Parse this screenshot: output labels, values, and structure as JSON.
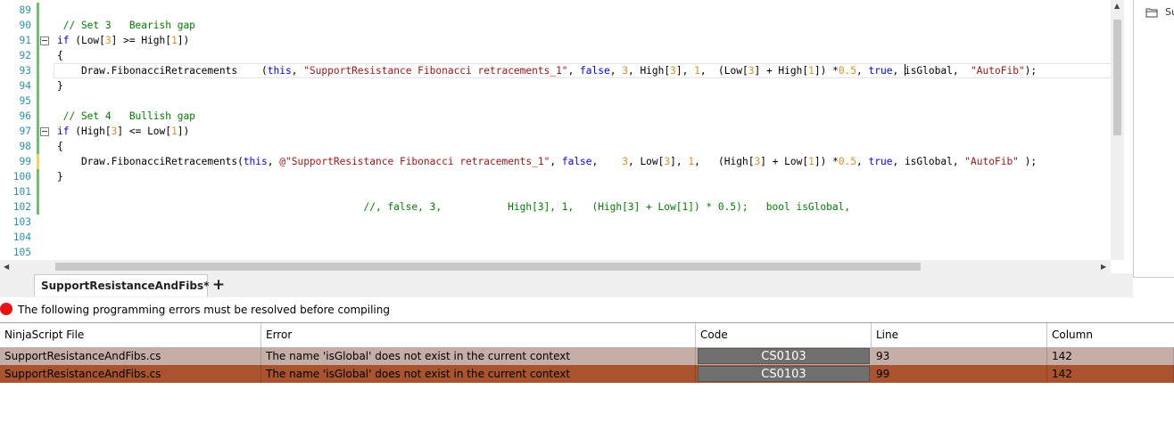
{
  "editor": {
    "lines": [
      {
        "n": "89",
        "marker": "g",
        "html": ""
      },
      {
        "n": "90",
        "marker": "g",
        "segs": [
          [
            "cm",
            " // Set 3   Bearish gap"
          ]
        ]
      },
      {
        "n": "91",
        "marker": "g",
        "fold": true,
        "segs": [
          [
            "kw",
            "if"
          ],
          [
            "",
            " (Low["
          ],
          [
            "num",
            "3"
          ],
          [
            "",
            "] >= High["
          ],
          [
            "num",
            "1"
          ],
          [
            "",
            "])"
          ]
        ]
      },
      {
        "n": "92",
        "marker": "g",
        "segs": [
          [
            "",
            "{"
          ]
        ]
      },
      {
        "n": "93",
        "marker": "g",
        "current": true,
        "segs": [
          [
            "",
            "    Draw.FibonacciRetracements    ("
          ],
          [
            "kw",
            "this"
          ],
          [
            "",
            ", "
          ],
          [
            "str",
            "\"SupportResistance Fibonacci retracements_1\""
          ],
          [
            "",
            ", "
          ],
          [
            "kw",
            "false"
          ],
          [
            "",
            ", "
          ],
          [
            "num",
            "3"
          ],
          [
            "",
            ", High["
          ],
          [
            "num",
            "3"
          ],
          [
            "",
            "], "
          ],
          [
            "num",
            "1"
          ],
          [
            "",
            ",  (Low["
          ],
          [
            "num",
            "3"
          ],
          [
            "",
            "] + High["
          ],
          [
            "num",
            "1"
          ],
          [
            "",
            "]) *"
          ],
          [
            "num",
            "0.5"
          ],
          [
            "",
            ", "
          ],
          [
            "kw",
            "true"
          ],
          [
            "",
            ", "
          ],
          [
            "caret",
            ""
          ],
          [
            "",
            "isGlobal,  "
          ],
          [
            "str",
            "\"AutoFib\""
          ],
          [
            "",
            ");"
          ]
        ]
      },
      {
        "n": "94",
        "marker": "g",
        "segs": [
          [
            "",
            "}"
          ]
        ]
      },
      {
        "n": "95",
        "marker": "g",
        "segs": []
      },
      {
        "n": "96",
        "marker": "g",
        "segs": [
          [
            "cm",
            " // Set 4   Bullish gap"
          ]
        ]
      },
      {
        "n": "97",
        "marker": "g",
        "fold": true,
        "segs": [
          [
            "kw",
            "if"
          ],
          [
            "",
            " (High["
          ],
          [
            "num",
            "3"
          ],
          [
            "",
            "] <= Low["
          ],
          [
            "num",
            "1"
          ],
          [
            "",
            "])"
          ]
        ]
      },
      {
        "n": "98",
        "marker": "g",
        "segs": [
          [
            "",
            "{"
          ]
        ]
      },
      {
        "n": "99",
        "marker": "y",
        "segs": [
          [
            "",
            "    Draw.FibonacciRetracements("
          ],
          [
            "kw",
            "this"
          ],
          [
            "",
            ", "
          ],
          [
            "str",
            "@\"SupportResistance Fibonacci retracements_1\""
          ],
          [
            "",
            ", "
          ],
          [
            "kw",
            "false"
          ],
          [
            "",
            ",    "
          ],
          [
            "num",
            "3"
          ],
          [
            "",
            ", Low["
          ],
          [
            "num",
            "3"
          ],
          [
            "",
            "], "
          ],
          [
            "num",
            "1"
          ],
          [
            "",
            ",   (High["
          ],
          [
            "num",
            "3"
          ],
          [
            "",
            "] + Low["
          ],
          [
            "num",
            "1"
          ],
          [
            "",
            "]) *"
          ],
          [
            "num",
            "0.5"
          ],
          [
            "",
            ", "
          ],
          [
            "kw",
            "true"
          ],
          [
            "",
            ", isGlobal, "
          ],
          [
            "str",
            "\"AutoFib\""
          ],
          [
            "",
            " );"
          ]
        ]
      },
      {
        "n": "100",
        "marker": "g",
        "segs": [
          [
            "",
            "}"
          ]
        ]
      },
      {
        "n": "101",
        "marker": "g",
        "segs": []
      },
      {
        "n": "102",
        "marker": "g",
        "segs": [
          [
            "cm",
            "                                                   //, false, 3,           High[3], 1,   (High[3] + Low[1]) * 0.5);   bool isGlobal,"
          ]
        ]
      },
      {
        "n": "103",
        "marker": "",
        "segs": []
      },
      {
        "n": "104",
        "marker": "",
        "segs": []
      },
      {
        "n": "105",
        "marker": "",
        "segs": []
      }
    ]
  },
  "right_panel": {
    "folder_label": "Su"
  },
  "tabs": {
    "document": "SupportResistanceAndFibs*",
    "add_label": "+"
  },
  "status": {
    "message": "The following programming errors must be resolved before compiling"
  },
  "errors": {
    "columns": [
      "NinjaScript File",
      "Error",
      "Code",
      "Line",
      "Column"
    ],
    "rows": [
      {
        "file": "SupportResistanceAndFibs.cs",
        "error": "The name 'isGlobal' does not exist in the current context",
        "code": "CS0103",
        "line": "93",
        "column": "142",
        "bg": "#c4aea5"
      },
      {
        "file": "SupportResistanceAndFibs.cs",
        "error": "The name 'isGlobal' does not exist in the current context",
        "code": "CS0103",
        "line": "99",
        "column": "142",
        "bg": "#a9532f"
      }
    ]
  }
}
